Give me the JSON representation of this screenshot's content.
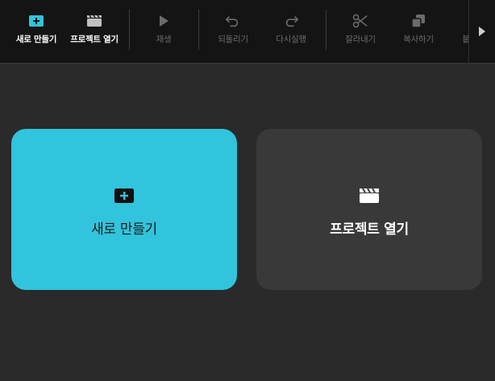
{
  "colors": {
    "accent": "#31c4dc",
    "toolbar_bg": "#141414",
    "page_bg": "#2a2a2a",
    "card_dark": "#393939",
    "disabled": "#6b6b6b"
  },
  "toolbar": {
    "items": [
      {
        "label": "새로 만들기",
        "icon": "new-project-icon",
        "state": "active"
      },
      {
        "label": "프로젝트 열기",
        "icon": "clapperboard-icon",
        "state": "active"
      },
      {
        "label": "재생",
        "icon": "play-icon",
        "state": "disabled"
      },
      {
        "label": "되돌리기",
        "icon": "undo-icon",
        "state": "disabled"
      },
      {
        "label": "다시실행",
        "icon": "redo-icon",
        "state": "disabled"
      },
      {
        "label": "잘라내기",
        "icon": "scissors-icon",
        "state": "disabled"
      },
      {
        "label": "복사하기",
        "icon": "copy-icon",
        "state": "disabled"
      },
      {
        "label": "붙",
        "icon": "paste-icon",
        "state": "disabled"
      }
    ],
    "more_icon": "chevron-right-icon"
  },
  "cards": {
    "new": {
      "label": "새로 만들기",
      "icon": "new-project-icon"
    },
    "open": {
      "label": "프로젝트 열기",
      "icon": "clapperboard-icon"
    }
  }
}
